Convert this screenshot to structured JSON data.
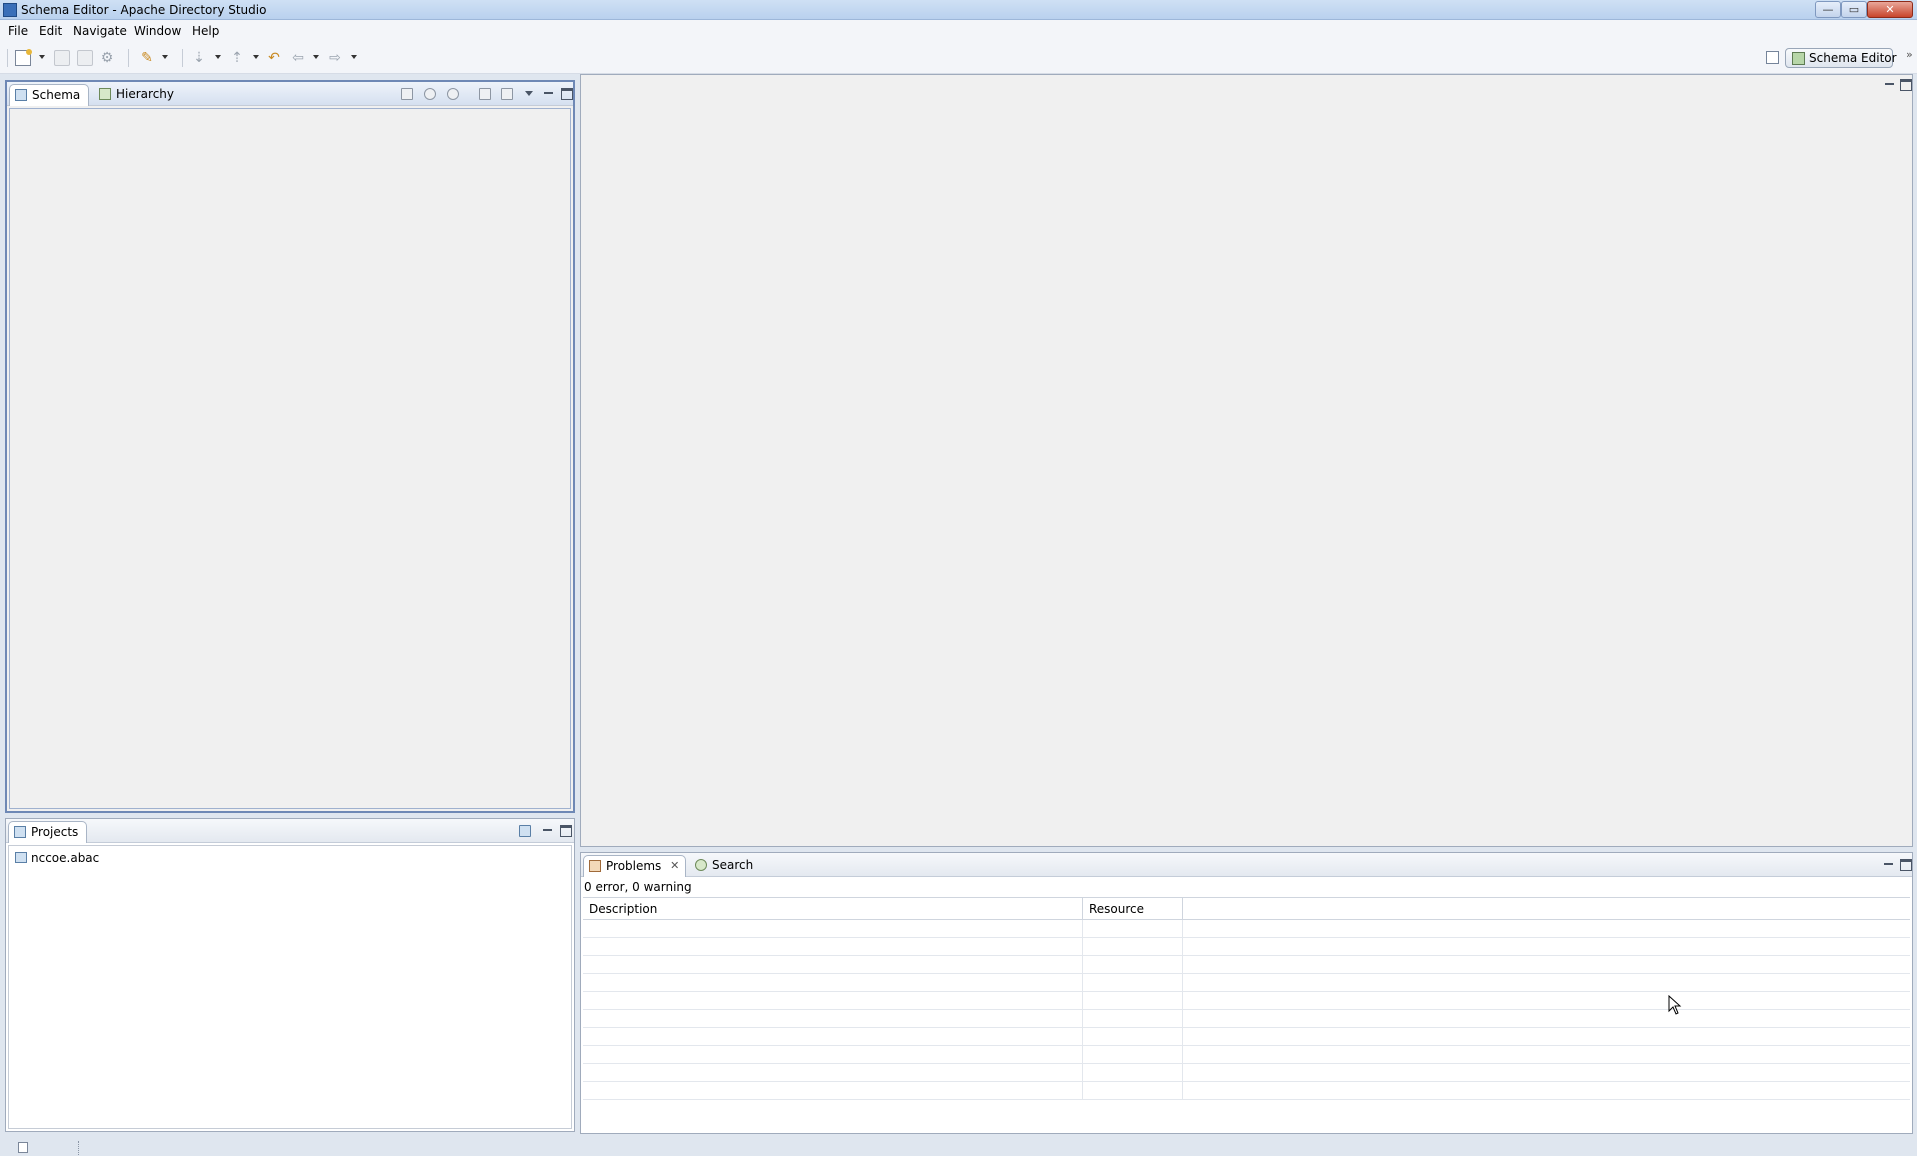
{
  "window": {
    "title": "Schema Editor - Apache Directory Studio"
  },
  "menu": {
    "items": [
      "File",
      "Edit",
      "Navigate",
      "Window",
      "Help"
    ]
  },
  "toolbar": {
    "icons": [
      "new-icon",
      "save-icon",
      "print-icon",
      "settings-icon",
      "open-schema-icon",
      "next-annotation-icon",
      "previous-annotation-icon",
      "last-edit-icon",
      "back-icon",
      "forward-icon"
    ]
  },
  "perspective": {
    "label": "Schema Editor"
  },
  "schema_view": {
    "tabs": [
      {
        "label": "Schema",
        "active": true
      },
      {
        "label": "Hierarchy",
        "active": false
      }
    ]
  },
  "projects_view": {
    "tab_label": "Projects",
    "items": [
      "nccoe.abac"
    ]
  },
  "problems_view": {
    "tabs": [
      {
        "label": "Problems",
        "active": true
      },
      {
        "label": "Search",
        "active": false
      }
    ],
    "summary": "0 error, 0 warning",
    "columns": [
      "Description",
      "Resource"
    ]
  },
  "colors": {
    "active_border": "#6e88b5",
    "close_button": "#c8452c"
  }
}
